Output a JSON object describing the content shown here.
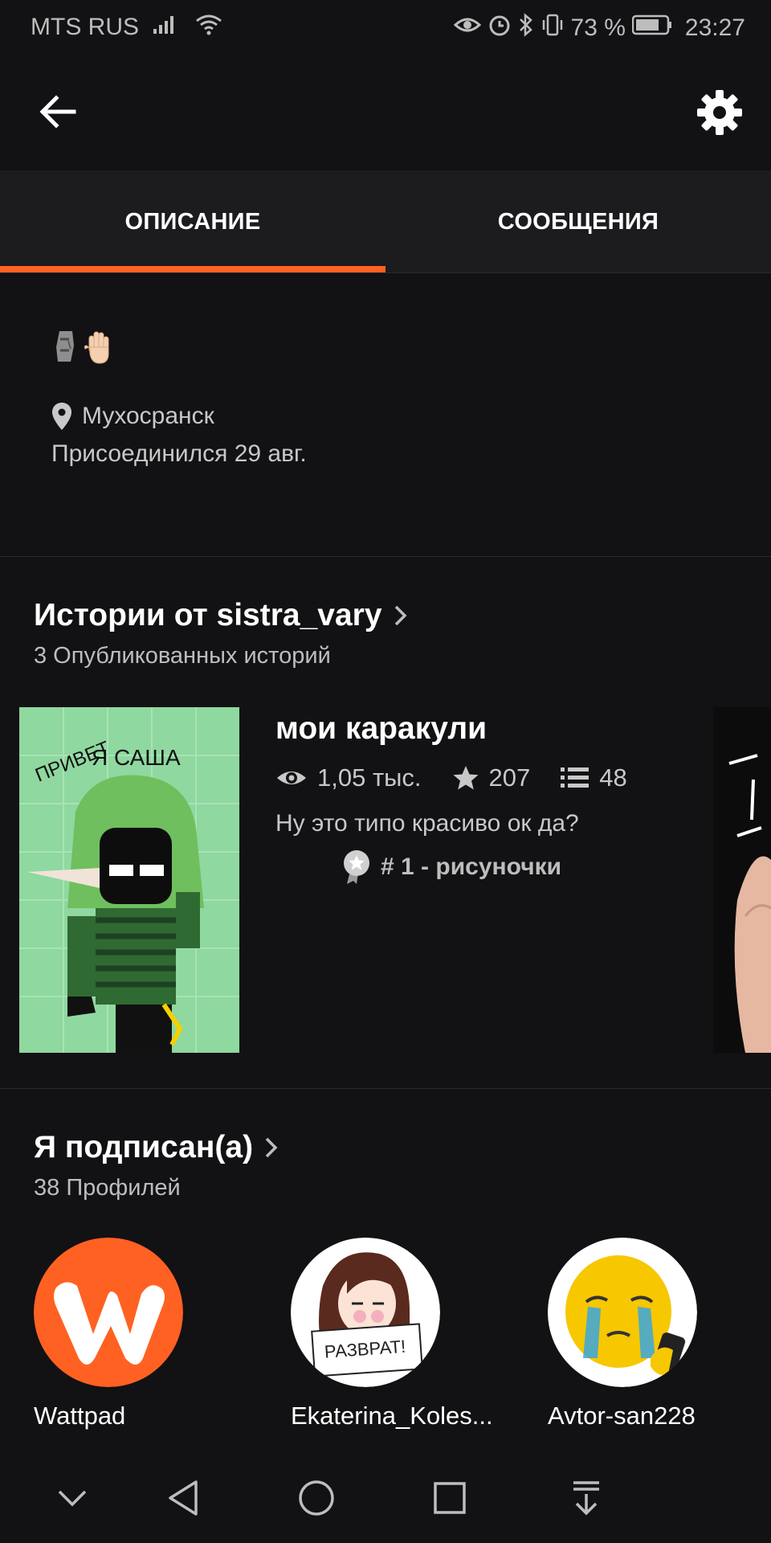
{
  "status_bar": {
    "carrier": "MTS RUS",
    "battery": "73 %",
    "time": "23:27",
    "icons": [
      "signal-icon",
      "wifi-icon",
      "eye-icon",
      "alarm-icon",
      "bluetooth-icon",
      "vibrate-icon",
      "battery-icon"
    ]
  },
  "app_bar": {
    "back_icon": "arrow-left-icon",
    "settings_icon": "gear-icon"
  },
  "tabs": [
    {
      "label": "ОПИСАНИЕ",
      "active": true
    },
    {
      "label": "СООБЩЕНИЯ",
      "active": false
    }
  ],
  "about": {
    "emoji": [
      "moai",
      "raised-hand"
    ],
    "location": "Мухосранск",
    "joined": "Присоединился 29 авг."
  },
  "stories": {
    "title": "Истории от sistra_vary",
    "count_label": "3 Опубликованных историй",
    "items": [
      {
        "title": "мои каракули",
        "views": "1,05 тыс.",
        "votes": "207",
        "parts": "48",
        "description": "Ну это типо красиво ок да?",
        "ranking": "# 1 - рисуночки",
        "cover_text_1": "ПРИВЕТ",
        "cover_text_2": "Я САША"
      }
    ]
  },
  "following": {
    "title": "Я подписан(а)",
    "count_label": "38 Профилей",
    "profiles": [
      {
        "name": "Wattpad"
      },
      {
        "name": "Ekaterina_Koles...",
        "sign_text": "РАЗВРАТ!"
      },
      {
        "name": "Avtor-san228"
      }
    ]
  },
  "colors": {
    "accent": "#ff6122",
    "background": "#121114",
    "tab_background": "#1c1b1e",
    "secondary_text": "#c8c8c8"
  }
}
